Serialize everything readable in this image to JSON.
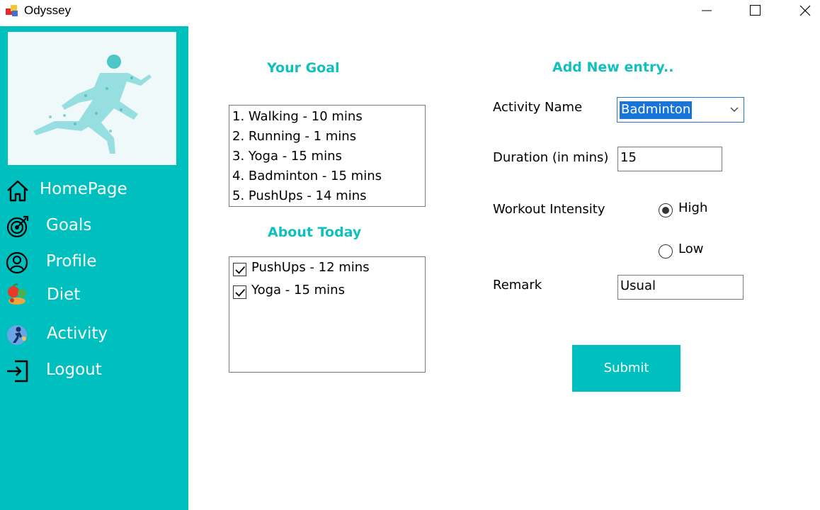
{
  "window": {
    "title": "Odyssey",
    "controls": [
      "minimize-icon",
      "maximize-icon",
      "close-icon"
    ]
  },
  "colors": {
    "sidebar": "#00BFBF",
    "accent_text": "#12BFC0",
    "selection": "#1874D8"
  },
  "sidebar": {
    "hero_image": "running-figure-illustration",
    "items": [
      {
        "label": "HomePage",
        "icon": "home-icon"
      },
      {
        "label": "Goals",
        "icon": "target-icon"
      },
      {
        "label": "Profile",
        "icon": "user-circle-icon"
      },
      {
        "label": "Diet",
        "icon": "fruits-icon"
      },
      {
        "label": "Activity",
        "icon": "activity-icon"
      },
      {
        "label": "Logout",
        "icon": "logout-icon"
      }
    ]
  },
  "goals": {
    "heading": "Your Goal",
    "items": [
      "1. Walking - 10 mins",
      "2. Running - 1 mins",
      "3. Yoga - 15 mins",
      "4. Badminton - 15 mins",
      "5. PushUps - 14 mins"
    ]
  },
  "today": {
    "heading": "About Today",
    "items": [
      {
        "label": "PushUps - 12 mins",
        "checked": true
      },
      {
        "label": "Yoga - 15 mins",
        "checked": true
      }
    ]
  },
  "entry_form": {
    "heading": "Add New entry..",
    "activity_label": "Activity Name",
    "activity_value": "Badminton",
    "duration_label": "Duration (in mins)",
    "duration_value": "15",
    "intensity_label": "Workout  Intensity",
    "intensity_options": [
      {
        "label": "High",
        "selected": true
      },
      {
        "label": "Low",
        "selected": false
      }
    ],
    "remark_label": "Remark",
    "remark_value": "Usual",
    "submit_label": "Submit"
  }
}
